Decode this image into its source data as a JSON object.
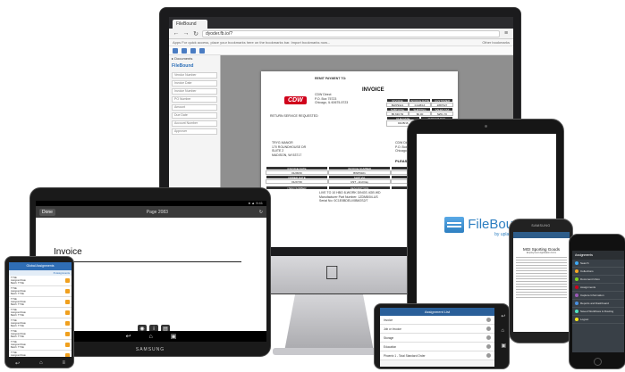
{
  "imac": {
    "tab_label": "FileBound",
    "address": "dyoder.fb.io/?",
    "bookmarks_hint": "Apps   For quick access, place your bookmarks here on the bookmarks bar.   Import bookmarks now...",
    "bookmark_other": "Other bookmarks",
    "left_panel_title": "FileBound",
    "left_fields": [
      "Vendor Number",
      "Invoice Date",
      "Invoice Number",
      "PO Number",
      "Amount",
      "Due Date",
      "Account Number",
      "Approver"
    ],
    "invoice": {
      "logo": "CDW",
      "title": "INVOICE",
      "remit_label": "REMIT PAYMENT TO:",
      "remit_address": "CDW Direct\nP.O. Box 75723\nChicago, IL 60675-5723",
      "return_label": "RETURN SERVICE REQUESTED",
      "bill_to": "TRYG MANOR\n170 ROUNDHOUSE DR\nSUITE 2\nMADISON, WI 53717",
      "ship_to": "CDW Direct\nP.O. Box 75723\nChicago, IL",
      "header_row_1": [
        "INVOICE NUMBER",
        "INVOICE DATE",
        "CUSTOMER NUMBER"
      ],
      "value_row_1": [
        "BWP9321",
        "01/28/16",
        "2887527"
      ],
      "header_row_2": [
        "SUBTOTAL",
        "SHIPPING",
        "SALES TAX"
      ],
      "value_row_2": [
        "$5,630.53",
        "$0.00",
        "$251.70"
      ],
      "header_row_3": [
        "DUE DATE",
        "AMOUNT DUE"
      ],
      "value_row_3": [
        "02/28/16",
        "$5,881.23"
      ],
      "please_return": "PLEASE RETURN",
      "table_headers": [
        "INVOICE DATE",
        "INVOICE NUMBER",
        "PAYMENT TERMS"
      ],
      "table_values": [
        "01/28/16",
        "BWP9321",
        "Net 30 Days"
      ],
      "table_headers_2": [
        "ORDER DATE",
        "SHIP VIA",
        "PURCHASE ORDER NO."
      ],
      "table_values_2": [
        "01/27/16",
        "UST - 2nd Day",
        "2735163"
      ],
      "line_headers": [
        "ITEM NUMBER",
        "DESCRIPTION",
        "QTY"
      ],
      "line_item": "LIVE TO 10 HBO 8-WORK DINGS 4GB WD",
      "line_item_2": "Manufacturer Part Number: 1ZDM8/04-US",
      "line_item_3": "Serial No: 0C1E0BDELI/0BM2S2/7"
    }
  },
  "samsung_tablet": {
    "done_label": "Done",
    "page_label": "Page 2083",
    "doc_title": "Invoice",
    "brand": "SAMSUNG",
    "nav_icons": [
      "back-icon",
      "home-icon",
      "recent-apps-icon"
    ]
  },
  "ipad": {
    "logo_name": "FileBound",
    "logo_sub": "by upland"
  },
  "galaxy": {
    "brand": "SAMSUNG",
    "title": "MGI Sporting Goods",
    "subtitle": "Employment Application Form"
  },
  "iphone": {
    "header": "Assignments",
    "items": [
      {
        "label": "Search",
        "color": "#3fa9f5"
      },
      {
        "label": "Collections",
        "color": "#f5a623"
      },
      {
        "label": "Document Inbox",
        "color": "#7ed321"
      },
      {
        "label": "Assignments",
        "color": "#d0021b"
      },
      {
        "label": "Capture Information",
        "color": "#9b59b6"
      },
      {
        "label": "Reports and Dashboard",
        "color": "#4a90e2"
      },
      {
        "label": "Saved Workflows & Routing",
        "color": "#50e3c2"
      },
      {
        "label": "Logout",
        "color": "#f8e71c"
      }
    ]
  },
  "android": {
    "header": "Global Assignments",
    "sub": "8 Assignments",
    "items": [
      {
        "text": "TYSE\nAssigned Date\nBatch: TYSE"
      },
      {
        "text": "TYSE\nAssigned Date\nBatch: TYSE"
      },
      {
        "text": "TYSE\nAssigned Date\nBatch: TYSE"
      },
      {
        "text": "TYSE\nAssigned Date\nBatch: TYSE"
      },
      {
        "text": "TYSE\nAssigned Date\nBatch: TYSE"
      },
      {
        "text": "TYSE\nAssigned Date\nBatch: TYSE"
      },
      {
        "text": "TYSE\nAssigned Date\nBatch: TYSE"
      },
      {
        "text": "TYSE\nAssigned Date\nBatch: TYSE"
      }
    ],
    "nav_icons": [
      "back-icon",
      "home-icon",
      "menu-icon"
    ]
  },
  "small_tablet": {
    "header": "Assignment List",
    "items": [
      "Invoice",
      "Job or Invoice",
      "Storage",
      "Education",
      "Phoenix 1 - Total Standard Order"
    ]
  }
}
